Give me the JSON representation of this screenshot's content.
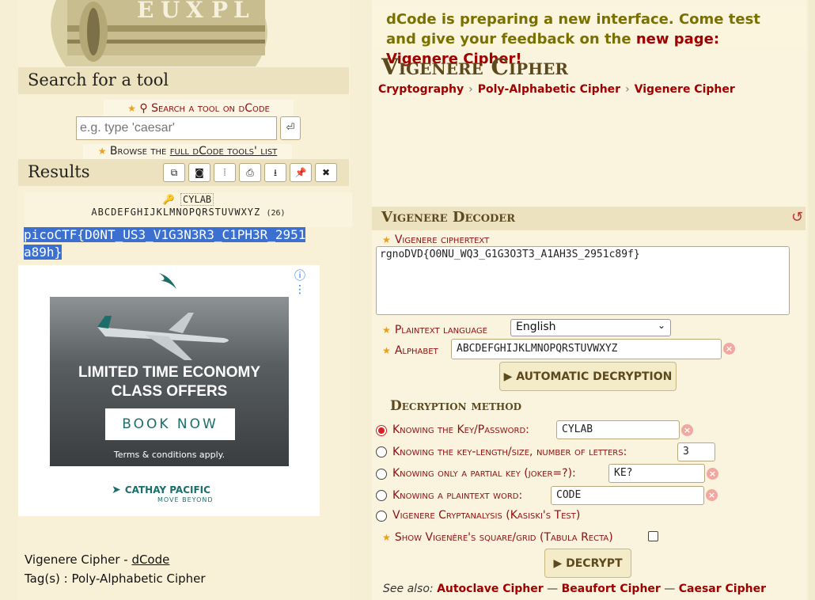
{
  "left": {
    "search_heading": "Search for a tool",
    "search_link": "Search a tool on dCode",
    "search_placeholder": "e.g. type 'caesar'",
    "search_go": "⏎",
    "browse_prefix": "Browse the",
    "browse_link": "full dCode tools' list",
    "results_heading": "Results",
    "tool_buttons": [
      "⧉",
      "◙",
      "⦙",
      "⎙",
      "⭳",
      "📌",
      "✖"
    ],
    "result_key": "CYLAB",
    "result_alphabet": "ABCDEFGHIJKLMNOPQRSTUVWXYZ",
    "result_alphabet_count": "(26)",
    "result_text_line1": "picoCTF{D0NT_US3_V1G3N3R3_C1PH3R_2951",
    "result_text_line2": "a89h}",
    "ad": {
      "headline_1": "LIMITED TIME ECONOMY",
      "headline_2": "CLASS OFFERS",
      "cta": "BOOK NOW",
      "terms": "Terms & conditions apply.",
      "brand": "CATHAY PACIFIC",
      "tagline": "MOVE BEYOND"
    },
    "footer_title": "Vigenere Cipher - ",
    "footer_link": "dCode",
    "footer_tags": "Tag(s) : Poly-Alphabetic Cipher"
  },
  "right": {
    "notice_text": "dCode is preparing a new interface. Come test and give your feedback on the ",
    "notice_link": "new page: Vigenere Cipher",
    "notice_end": "!",
    "title": "Vigenere Cipher",
    "breadcrumbs": [
      "Cryptography",
      "Poly-Alphabetic Cipher",
      "Vigenere Cipher"
    ],
    "decoder_heading": "Vigenere Decoder",
    "reset": "↺",
    "ciphertext_label": "Vigenere ciphertext",
    "ciphertext_value": "rgnoDVD{O0NU_WQ3_G1G3O3T3_A1AH3S_2951c89f}",
    "language_label": "Plaintext language",
    "language_value": "English",
    "alphabet_label": "Alphabet",
    "alphabet_value": "ABCDEFGHIJKLMNOPQRSTUVWXYZ",
    "auto_button": "▶ AUTOMATIC DECRYPTION",
    "method_heading": "Decryption method",
    "options": [
      {
        "label": "Knowing the Key/Password:",
        "value": "CYLAB"
      },
      {
        "label": "Knowing the key-length/size, number of letters:",
        "value": "3"
      },
      {
        "label": "Knowing only a partial key (joker=?):",
        "value": "KE?"
      },
      {
        "label": "Knowing a plaintext word:",
        "value": "CODE"
      },
      {
        "label": "Vigenere Cryptanalysis (Kasiski's Test)"
      }
    ],
    "show_grid_label": "Show Vigenère's square/grid (Tabula Recta)",
    "decrypt_button": "▶ DECRYPT",
    "see_also_label": "See also:",
    "see_also": [
      "Autoclave Cipher",
      "Beaufort Cipher",
      "Caesar Cipher"
    ]
  },
  "colors": {
    "accent": "#a00000",
    "highlight": "#3b6fd0",
    "panel": "#ece2bf"
  }
}
